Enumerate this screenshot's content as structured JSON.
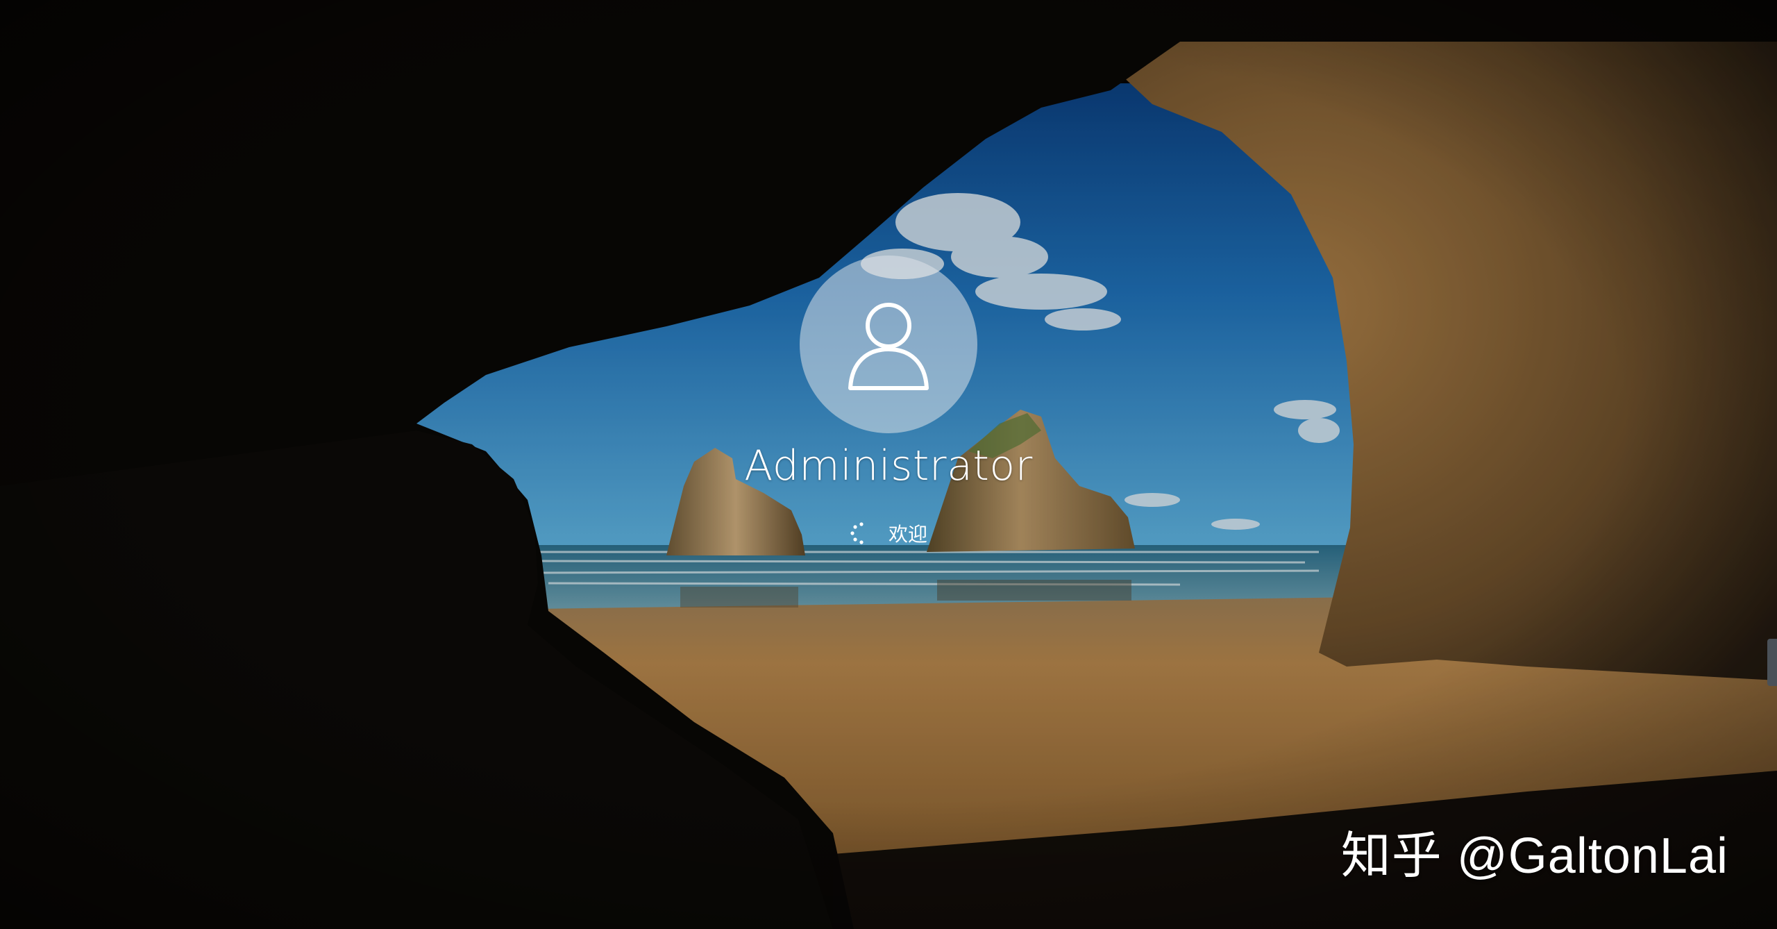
{
  "login": {
    "username": "Administrator",
    "status_text": "欢迎",
    "avatar_icon": "user-icon",
    "spinner_icon": "loading-spinner-icon"
  },
  "watermark": {
    "text": "知乎 @GaltonLai"
  },
  "colors": {
    "sky_top": "#0f4a8c",
    "sky_horizon": "#4fa3d6",
    "sand": "#a8773a",
    "cave_rock": "#1a1510",
    "avatar_bg": "#c8ced4"
  }
}
